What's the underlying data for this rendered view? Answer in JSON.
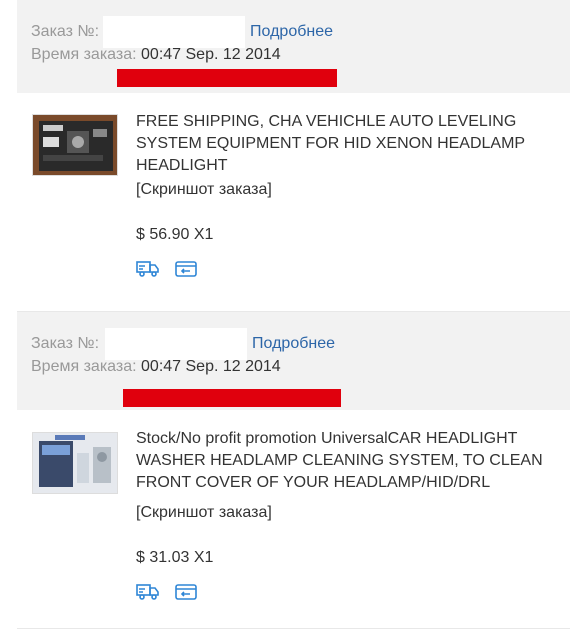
{
  "colors": {
    "link": "#2d66a8",
    "header_bg": "#f2f2f2",
    "redaction": "#e0000d",
    "icon_blue": "#2f86d6"
  },
  "orders": [
    {
      "order_label": "Заказ №:",
      "details_link": "Подробнее",
      "time_label": "Время заказа:",
      "time_value": "00:47 Sep. 12 2014",
      "item": {
        "title": "FREE SHIPPING, CHA VEHICHLE AUTO LEVELING SYSTEM EQUIPMENT FOR HID XENON HEADLAMP HEADLIGHT",
        "screenshot_link": "[Скриншот заказа]",
        "price": "$ 56.90 X1",
        "icons": [
          "delivery-truck-icon",
          "return-icon"
        ]
      }
    },
    {
      "order_label": "Заказ №:",
      "details_link": "Подробнее",
      "time_label": "Время заказа:",
      "time_value": "00:47 Sep. 12 2014",
      "item": {
        "title": "Stock/No profit promotion UniversalCAR HEADLIGHT WASHER HEADLAMP CLEANING SYSTEM, TO CLEAN FRONT COVER OF YOUR HEADLAMP/HID/DRL",
        "screenshot_link": "[Скриншот заказа]",
        "price": "$ 31.03 X1",
        "icons": [
          "delivery-truck-icon",
          "return-icon"
        ]
      }
    }
  ]
}
